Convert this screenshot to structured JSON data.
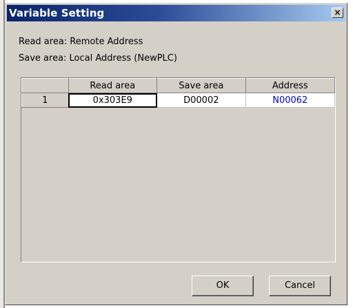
{
  "dialog": {
    "title": "Variable Setting",
    "close_label": "×"
  },
  "info": {
    "read_area": "Read area: Remote Address",
    "save_area": "Save area: Local Address (NewPLC)"
  },
  "table": {
    "headers": [
      "",
      "Read area",
      "Save area",
      "Address"
    ],
    "rows": [
      {
        "num": "1",
        "read": "0x303E9",
        "save": "D00002",
        "address": "N00062"
      }
    ]
  },
  "buttons": {
    "ok": "OK",
    "cancel": "Cancel"
  },
  "colors": {
    "title_start": "#0a246a",
    "title_end": "#a6caf0",
    "face": "#d4d0c8",
    "address_text": "#0000c8"
  }
}
